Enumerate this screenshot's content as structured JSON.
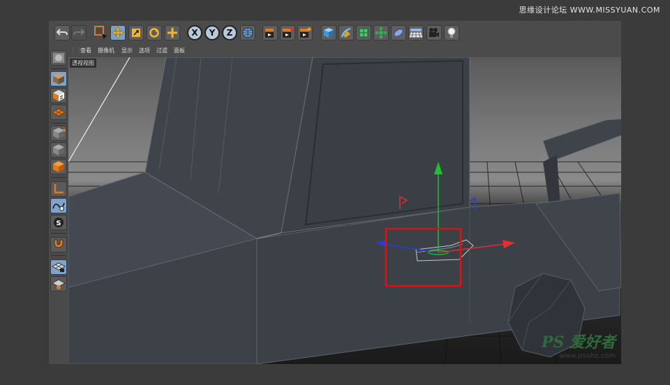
{
  "watermark_top": "思缘设计论坛 WWW.MISSYUAN.COM",
  "watermark_bottom": {
    "logo": "PS 爱好者",
    "url": "www.psahz.com"
  },
  "menubar": {
    "items": [
      "查看",
      "摄像机",
      "显示",
      "选项",
      "过滤",
      "面板"
    ]
  },
  "viewport": {
    "label": "透视视图"
  },
  "toolbar": {
    "axis_buttons": [
      "X",
      "Y",
      "Z"
    ],
    "icons": [
      "undo-icon",
      "redo-icon",
      "live-selection-icon",
      "move-icon",
      "scale-icon",
      "rotate-icon",
      "add-icon",
      "x-axis-icon",
      "y-axis-icon",
      "z-axis-icon",
      "world-coordinates-icon",
      "render-view-icon",
      "render-picture-viewer-icon",
      "render-settings-icon",
      "cube-icon",
      "pen-icon",
      "subdivision-icon",
      "cloner-icon",
      "deformer-icon",
      "floor-icon",
      "camera-icon",
      "light-icon"
    ]
  },
  "sidebar": {
    "icons": [
      "make-editable-icon",
      "model-mode-icon",
      "texture-mode-icon",
      "workplane-mode-icon",
      "points-mode-icon",
      "edges-mode-icon",
      "polygons-mode-icon",
      "axis-mode-icon",
      "tweak-mode-icon",
      "solo-mode-icon",
      "snap-icon",
      "workplane-lock-icon",
      "workplane-grid-icon"
    ]
  },
  "highlight": {
    "color": "#e01010"
  },
  "gizmo_colors": {
    "x": "#e03030",
    "y": "#20c030",
    "z": "#2040e0"
  }
}
